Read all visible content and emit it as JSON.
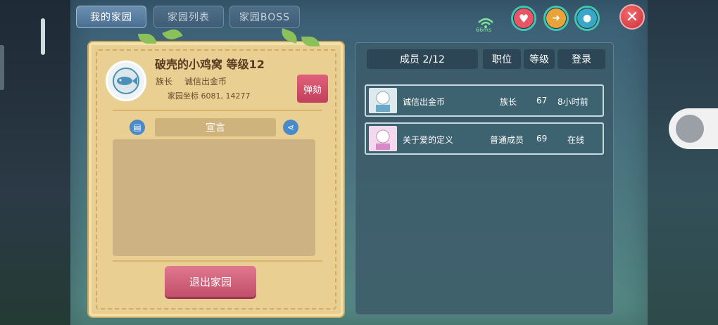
{
  "tabs": [
    {
      "label": "我的家园",
      "active": true
    },
    {
      "label": "家园列表",
      "active": false
    },
    {
      "label": "家园BOSS",
      "active": false
    }
  ],
  "status": {
    "ping": "66ms"
  },
  "home": {
    "title": "破壳的小鸡窝 等级12",
    "leader_label": "族长",
    "leader_name": "诚信出金币",
    "coord": "家园坐标 6081, 14277",
    "impeach_label": "弹劾",
    "declaration_label": "宣言",
    "exit_label": "退出家园"
  },
  "members": {
    "columns": [
      "成员 2/12",
      "职位",
      "等级",
      "登录"
    ],
    "rows": [
      {
        "name": "诚信出金币",
        "role": "族长",
        "level": "67",
        "login": "8小时前"
      },
      {
        "name": "关于爱的定义",
        "role": "普通成员",
        "level": "69",
        "login": "在线"
      }
    ]
  },
  "colors": {
    "accent": "#3fc7b3",
    "close": "#c92f3a",
    "button": "#c24e6a"
  }
}
